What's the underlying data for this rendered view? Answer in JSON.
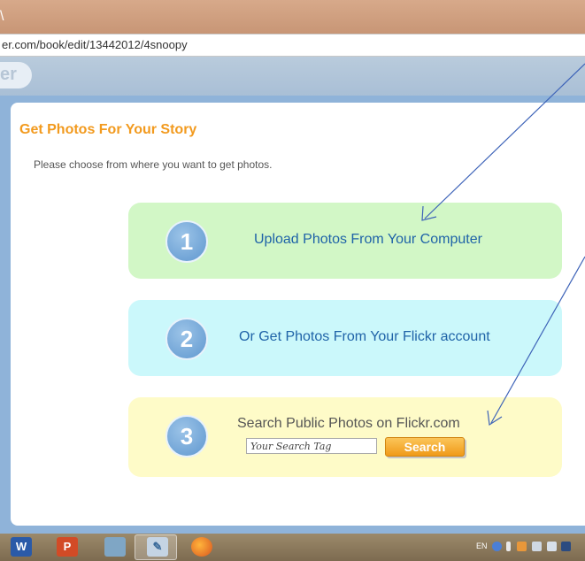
{
  "browser": {
    "url_text": "er.com/book/edit/13442012/4snoopy"
  },
  "site": {
    "logo_fragment": "er"
  },
  "panel": {
    "title": "Get Photos For Your Story",
    "subtitle": "Please choose from where you want to get photos."
  },
  "options": [
    {
      "number": "1",
      "label": "Upload Photos From Your Computer"
    },
    {
      "number": "2",
      "label": "Or Get Photos From Your Flickr account"
    },
    {
      "number": "3",
      "label": "Search Public Photos on Flickr.com"
    }
  ],
  "search": {
    "placeholder": "Your Search Tag",
    "button_label": "Search"
  },
  "taskbar": {
    "apps": [
      "word-icon",
      "powerpoint-icon",
      "calculator-icon",
      "paint-icon",
      "firefox-icon"
    ],
    "word_glyph": "W",
    "powerpoint_glyph": "P",
    "tray_language": "EN"
  },
  "colors": {
    "title_orange": "#f29a1e",
    "option1_bg": "#d2f7c6",
    "option2_bg": "#cbf8fb",
    "option3_bg": "#fefbc8",
    "number_circle": "#6fa3d6",
    "annotation_arrow": "#3d63b8"
  }
}
